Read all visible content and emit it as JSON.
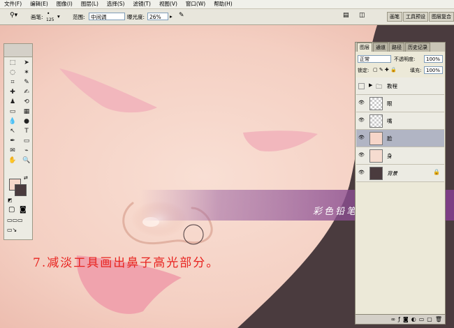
{
  "menu": [
    "文件(F)",
    "编辑(E)",
    "图像(I)",
    "图层(L)",
    "选择(S)",
    "滤镜(T)",
    "视图(V)",
    "窗口(W)",
    "帮助(H)"
  ],
  "options": {
    "brush_label": "画笔:",
    "brush_size": "125",
    "range_label": "范围:",
    "range_value": "中间调",
    "exposure_label": "曝光度:",
    "exposure_value": "26%"
  },
  "wells": [
    "画笔",
    "工具预设",
    "图层复合"
  ],
  "layers_panel": {
    "tabs": [
      "图层",
      "通道",
      "路径",
      "历史记录"
    ],
    "blend_mode": "正常",
    "opacity_label": "不透明度:",
    "opacity_value": "100%",
    "lock_label": "锁定:",
    "fill_label": "填充:",
    "fill_value": "100%",
    "layers": [
      {
        "name": "教程",
        "kind": "folder",
        "visible": false
      },
      {
        "name": "眼",
        "kind": "layer",
        "visible": true
      },
      {
        "name": "嘴",
        "kind": "layer",
        "visible": true
      },
      {
        "name": "脸",
        "kind": "layer",
        "visible": true,
        "selected": true
      },
      {
        "name": "身",
        "kind": "layer",
        "visible": true
      },
      {
        "name": "背景",
        "kind": "background",
        "visible": true,
        "locked": true
      }
    ]
  },
  "banner": "彩色铅笔-清 原创教程",
  "caption": "7.减淡工具画出鼻子高光部分。",
  "colors": {
    "foreground": "#f6d6c9",
    "background": "#4a3b3e",
    "accent_caption": "#e8231f",
    "banner": "#8a4a8e"
  },
  "tools": [
    "marquee-tool",
    "move-tool",
    "lasso-tool",
    "magic-wand-tool",
    "crop-tool",
    "slice-tool",
    "healing-brush-tool",
    "brush-tool",
    "clone-stamp-tool",
    "history-brush-tool",
    "eraser-tool",
    "gradient-tool",
    "blur-tool",
    "dodge-tool",
    "path-selection-tool",
    "type-tool",
    "pen-tool",
    "shape-tool",
    "notes-tool",
    "eyedropper-tool",
    "hand-tool",
    "zoom-tool"
  ]
}
